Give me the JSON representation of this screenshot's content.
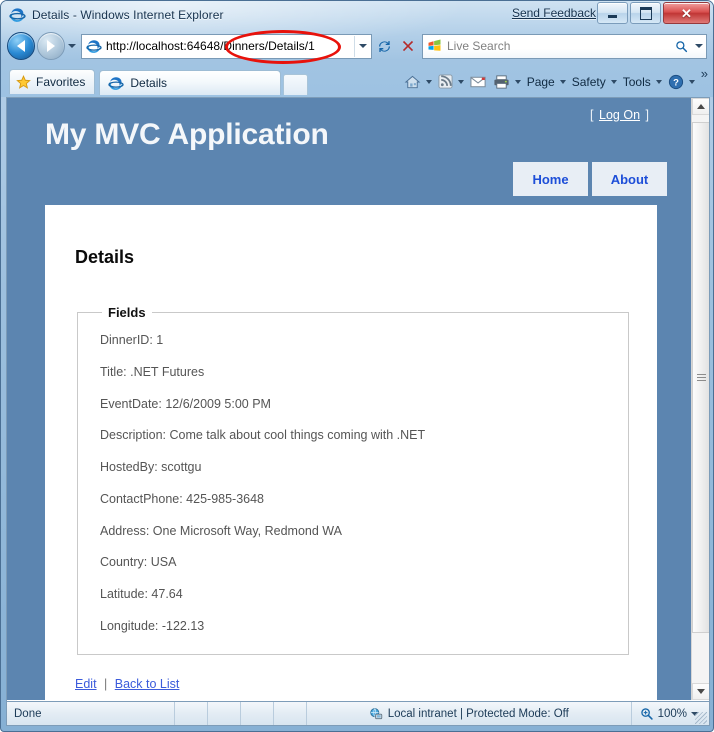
{
  "window": {
    "title": "Details - Windows Internet Explorer",
    "send_feedback": "Send Feedback",
    "minimize_label": "Minimize",
    "maximize_label": "Maximize",
    "close_label": "Close",
    "close_glyph": "✕"
  },
  "navigation": {
    "back_label": "Back",
    "forward_label": "Forward",
    "recent_pages_label": "Recent Pages",
    "address_url": "http://localhost:64648/Dinners/Details/1",
    "address_dropdown_label": "Address dropdown",
    "refresh_glyph": "↻",
    "refresh_label": "Refresh",
    "stop_glyph": "✕",
    "stop_label": "Stop",
    "search_placeholder": "Live Search",
    "search_go_label": "Search",
    "search_dropdown_label": "Search provider options"
  },
  "tabs": {
    "favorites_label": "Favorites",
    "open_tabs": [
      {
        "label": "Details"
      }
    ],
    "new_tab_label": "New Tab"
  },
  "command_bar": {
    "home_label": "Home",
    "feeds_label": "Feeds",
    "read_mail_label": "Read Mail",
    "print_label": "Print",
    "items": [
      {
        "label": "Page"
      },
      {
        "label": "Safety"
      },
      {
        "label": "Tools"
      }
    ],
    "help_label": "Help",
    "overflow_label": "»"
  },
  "page": {
    "site_title": "My MVC Application",
    "logon": {
      "bracket_open": "[",
      "link_label": "Log On",
      "bracket_close": "]"
    },
    "menu": [
      {
        "label": "Home"
      },
      {
        "label": "About"
      }
    ],
    "heading": "Details",
    "fieldset_legend": "Fields",
    "fields": [
      {
        "label": "DinnerID",
        "value": "1",
        "text": "DinnerID: 1"
      },
      {
        "label": "Title",
        "value": ".NET Futures",
        "text": "Title: .NET Futures"
      },
      {
        "label": "EventDate",
        "value": "12/6/2009 5:00 PM",
        "text": "EventDate: 12/6/2009 5:00 PM"
      },
      {
        "label": "Description",
        "value": "Come talk about cool things coming with .NET",
        "text": "Description: Come talk about cool things coming with .NET"
      },
      {
        "label": "HostedBy",
        "value": "scottgu",
        "text": "HostedBy: scottgu"
      },
      {
        "label": "ContactPhone",
        "value": "425-985-3648",
        "text": "ContactPhone: 425-985-3648"
      },
      {
        "label": "Address",
        "value": "One Microsoft Way, Redmond WA",
        "text": "Address: One Microsoft Way, Redmond WA"
      },
      {
        "label": "Country",
        "value": "USA",
        "text": "Country: USA"
      },
      {
        "label": "Latitude",
        "value": "47.64",
        "text": "Latitude: 47.64"
      },
      {
        "label": "Longitude",
        "value": "-122.13",
        "text": "Longitude: -122.13"
      }
    ],
    "actions": {
      "edit_label": "Edit",
      "separator": "|",
      "back_to_list_label": "Back to List"
    },
    "colors": {
      "header_blue": "#5c85b0",
      "link_blue": "#1d4ed8",
      "field_text": "#555555"
    }
  },
  "status_bar": {
    "status_text": "Done",
    "zone_text": "Local intranet | Protected Mode: Off",
    "zoom_level": "100%"
  },
  "annotation": {
    "shape": "red-ellipse",
    "highlights": "/Dinners/Details/1"
  }
}
